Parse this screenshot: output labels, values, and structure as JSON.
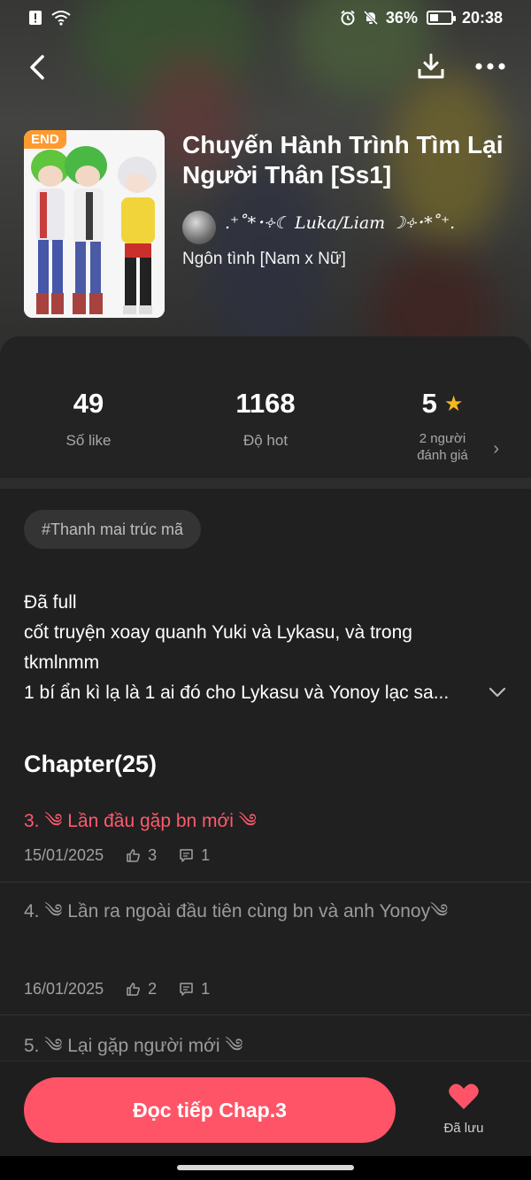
{
  "status_bar": {
    "battery": "36%",
    "time": "20:38"
  },
  "header": {
    "end_badge": "END",
    "title": "Chuyến Hành Trình Tìm Lại Người Thân [Ss1]",
    "author": ".⁺˚*･༓☾ Luka/Liam ☽༓･*˚⁺.",
    "genre": "Ngôn tình [Nam x Nữ]",
    "icons": [
      "back-icon",
      "download-icon",
      "more-icon"
    ]
  },
  "stats": [
    {
      "value": "49",
      "label": "Số like"
    },
    {
      "value": "1168",
      "label": "Độ hot"
    },
    {
      "value": "5",
      "label_line1": "2 người",
      "label_line2": "đánh giá"
    }
  ],
  "tag": "#Thanh mai trúc mã",
  "description": {
    "l1": "Đã full",
    "l2": "cốt truyện xoay quanh Yuki và Lykasu, và trong",
    "l3": "tkmlnmm",
    "l4": "1 bí ẩn kì lạ là 1 ai đó cho Lykasu và Yonoy lạc sa..."
  },
  "chapter_heading": "Chapter(25)",
  "chapters": [
    {
      "title": "3. ༄ Lần đầu gặp bn mới ༄",
      "date": "15/01/2025",
      "likes": "3",
      "comments": "1"
    },
    {
      "title": "4. ༄ Lần ra ngoài đầu tiên cùng bn và anh Yonoy༄",
      "date": "16/01/2025",
      "likes": "2",
      "comments": "1"
    },
    {
      "title": "5. ༄ Lại gặp người mới ༄"
    }
  ],
  "bottom": {
    "read_button": "Đọc tiếp Chap.3",
    "saved_label": "Đã lưu"
  },
  "colors": {
    "accent": "#ff5468",
    "active_chapter": "#ff5a6e",
    "star": "#f5b81d",
    "end_badge": "#ff9a2e"
  }
}
